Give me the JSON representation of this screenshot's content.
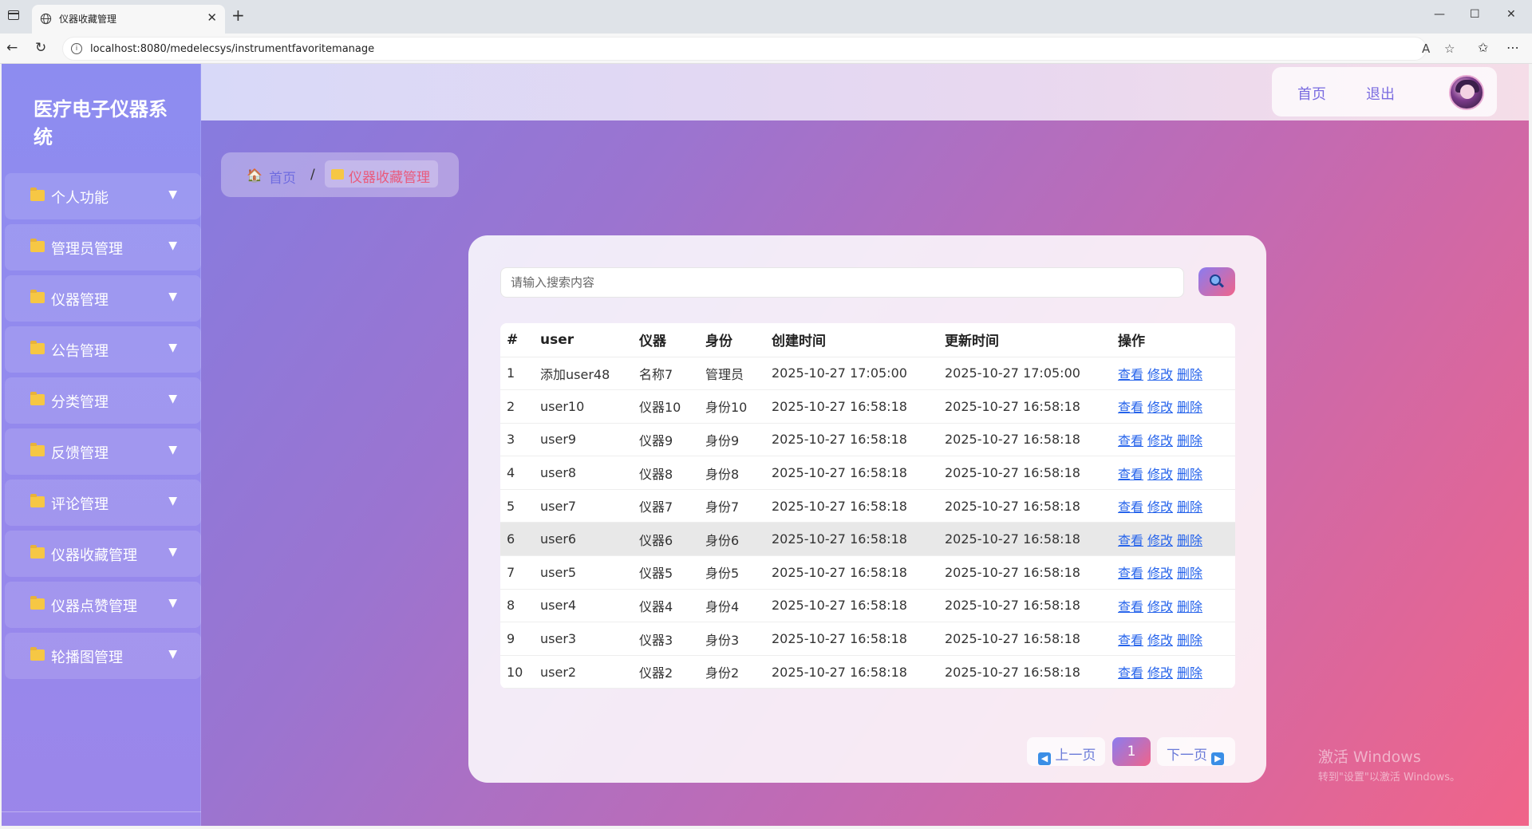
{
  "browser": {
    "tab_title": "仪器收藏管理",
    "url": "localhost:8080/medelecsys/instrumentfavoritemanage"
  },
  "app": {
    "title": "医疗电子仪器系统"
  },
  "header": {
    "home": "首页",
    "logout": "退出"
  },
  "sidebar": {
    "items": [
      {
        "label": "个人功能"
      },
      {
        "label": "管理员管理"
      },
      {
        "label": "仪器管理"
      },
      {
        "label": "公告管理"
      },
      {
        "label": "分类管理"
      },
      {
        "label": "反馈管理"
      },
      {
        "label": "评论管理"
      },
      {
        "label": "仪器收藏管理"
      },
      {
        "label": "仪器点赞管理"
      },
      {
        "label": "轮播图管理"
      }
    ]
  },
  "breadcrumb": {
    "home": "首页",
    "separator": "/",
    "current": "仪器收藏管理"
  },
  "search": {
    "placeholder": "请输入搜索内容"
  },
  "table": {
    "columns": [
      "#",
      "user",
      "仪器",
      "身份",
      "创建时间",
      "更新时间",
      "操作"
    ],
    "actions": {
      "view": "查看",
      "edit": "修改",
      "delete": "删除"
    },
    "rows": [
      {
        "id": "1",
        "user": "添加user48",
        "instrument": "名称7",
        "identity": "管理员",
        "created": "2025-10-27 17:05:00",
        "updated": "2025-10-27 17:05:00"
      },
      {
        "id": "2",
        "user": "user10",
        "instrument": "仪器10",
        "identity": "身份10",
        "created": "2025-10-27 16:58:18",
        "updated": "2025-10-27 16:58:18"
      },
      {
        "id": "3",
        "user": "user9",
        "instrument": "仪器9",
        "identity": "身份9",
        "created": "2025-10-27 16:58:18",
        "updated": "2025-10-27 16:58:18"
      },
      {
        "id": "4",
        "user": "user8",
        "instrument": "仪器8",
        "identity": "身份8",
        "created": "2025-10-27 16:58:18",
        "updated": "2025-10-27 16:58:18"
      },
      {
        "id": "5",
        "user": "user7",
        "instrument": "仪器7",
        "identity": "身份7",
        "created": "2025-10-27 16:58:18",
        "updated": "2025-10-27 16:58:18"
      },
      {
        "id": "6",
        "user": "user6",
        "instrument": "仪器6",
        "identity": "身份6",
        "created": "2025-10-27 16:58:18",
        "updated": "2025-10-27 16:58:18"
      },
      {
        "id": "7",
        "user": "user5",
        "instrument": "仪器5",
        "identity": "身份5",
        "created": "2025-10-27 16:58:18",
        "updated": "2025-10-27 16:58:18"
      },
      {
        "id": "8",
        "user": "user4",
        "instrument": "仪器4",
        "identity": "身份4",
        "created": "2025-10-27 16:58:18",
        "updated": "2025-10-27 16:58:18"
      },
      {
        "id": "9",
        "user": "user3",
        "instrument": "仪器3",
        "identity": "身份3",
        "created": "2025-10-27 16:58:18",
        "updated": "2025-10-27 16:58:18"
      },
      {
        "id": "10",
        "user": "user2",
        "instrument": "仪器2",
        "identity": "身份2",
        "created": "2025-10-27 16:58:18",
        "updated": "2025-10-27 16:58:18"
      }
    ]
  },
  "pagination": {
    "prev": "上一页",
    "current": "1",
    "next": "下一页"
  },
  "watermark": {
    "line1": "激活 Windows",
    "line2": "转到\"设置\"以激活 Windows。"
  }
}
